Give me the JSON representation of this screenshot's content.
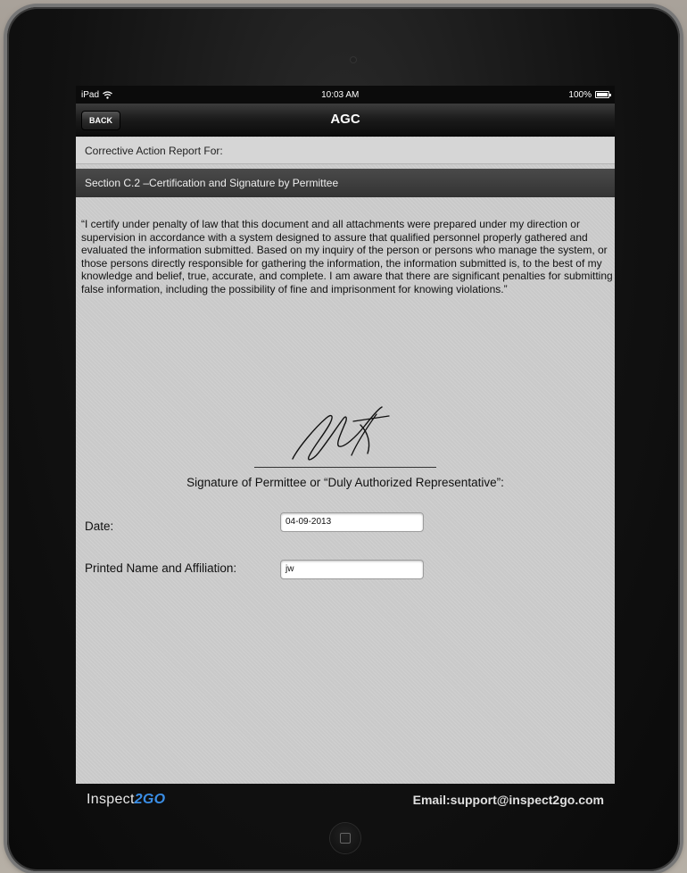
{
  "status_bar": {
    "device": "iPad",
    "time": "10:03 AM",
    "battery": "100%"
  },
  "nav": {
    "back_label": "BACK",
    "title": "AGC"
  },
  "report_for": "Corrective Action Report For:",
  "section_title": "Section C.2 –Certification and Signature by Permittee",
  "certification_text": "“I certify under penalty of law that this document and all attachments were prepared under my direction or supervision in accordance with a system designed to assure that qualified personnel properly gathered and evaluated the information submitted. Based on my inquiry of the person or persons who manage the system, or those persons directly responsible for gathering the information, the information submitted is, to the best of my knowledge and belief, true, accurate, and complete. I am aware that there are significant penalties for submitting false information, including the possibility of fine and imprisonment for knowing violations.”",
  "signature_label": "Signature of Permittee or  “Duly Authorized Representative”:",
  "form": {
    "date_label": "Date:",
    "date_value": "04-09-2013",
    "name_label": "Printed Name and Affiliation:",
    "name_value": "jw"
  },
  "footer": {
    "brand_prefix": "Inspect",
    "brand_accent": "2GO",
    "email": "Email:support@inspect2go.com"
  },
  "colors": {
    "accent": "#3a8ee6",
    "screen_bg": "#c9c9c9",
    "section_bar": "#3d3d3d"
  }
}
